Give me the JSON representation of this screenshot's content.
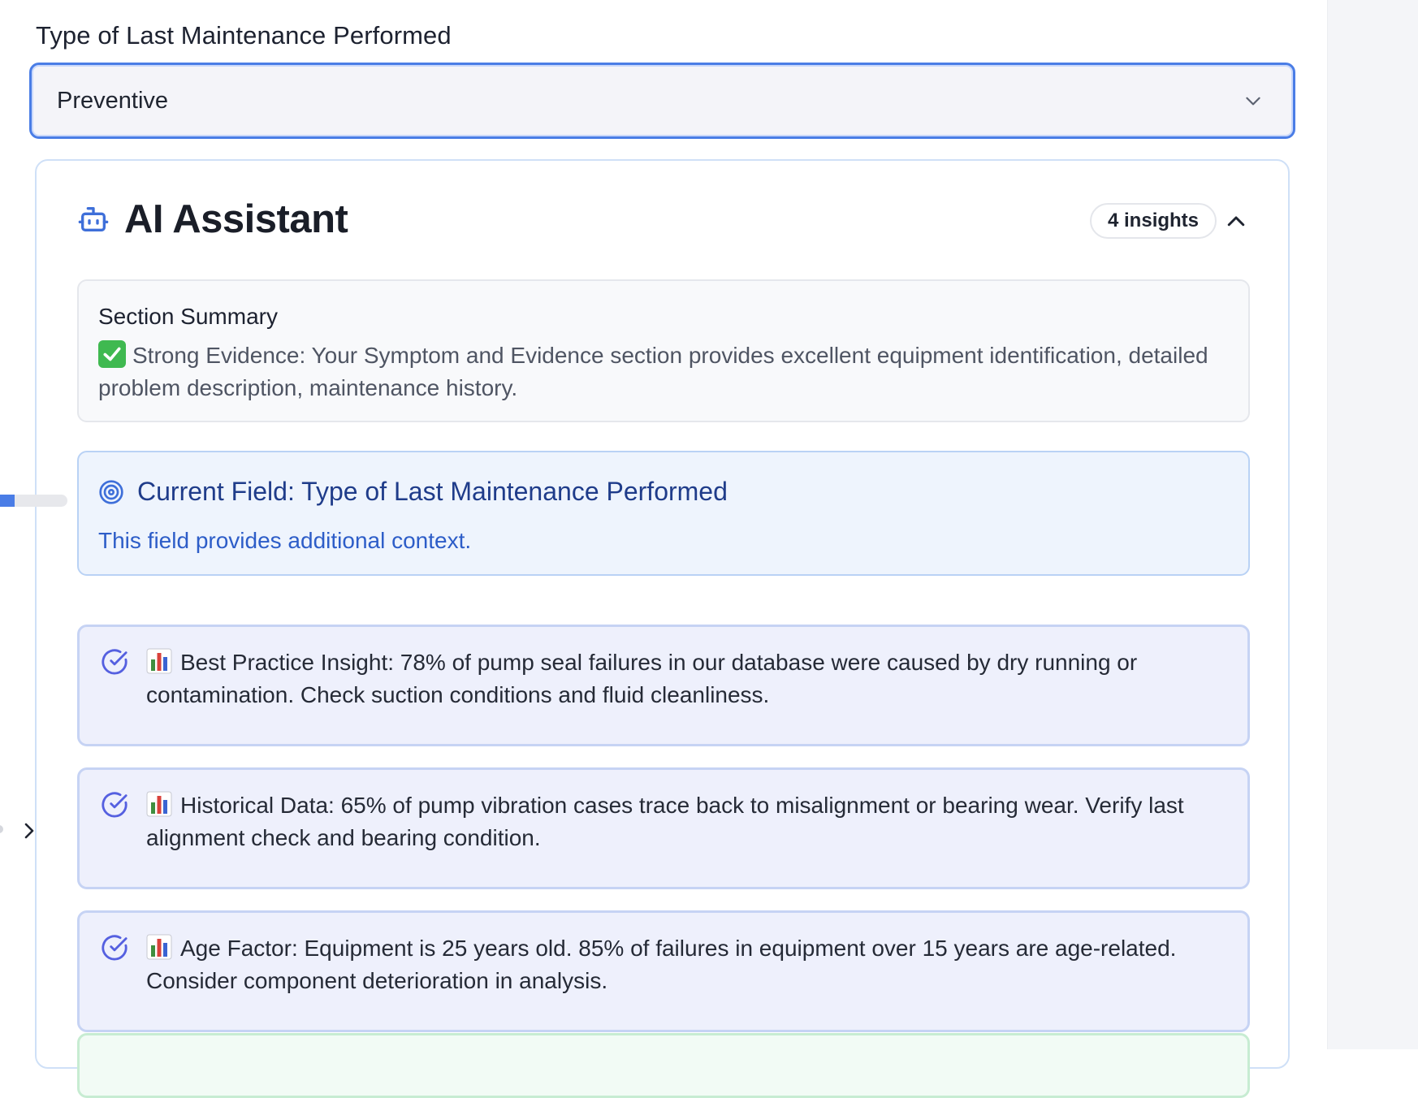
{
  "field": {
    "label": "Type of Last Maintenance Performed",
    "selected_value": "Preventive"
  },
  "ai_assistant": {
    "title": "AI Assistant",
    "insights_badge": "4 insights",
    "summary": {
      "title": "Section Summary",
      "text": "Strong Evidence: Your Symptom and Evidence section provides excellent equipment identification, detailed problem description, maintenance history."
    },
    "current_field": {
      "title": "Current Field: Type of Last Maintenance Performed",
      "description": "This field provides additional context."
    },
    "insights": [
      {
        "text": "Best Practice Insight: 78% of pump seal failures in our database were caused by dry running or contamination. Check suction conditions and fluid cleanliness."
      },
      {
        "text": "Historical Data: 65% of pump vibration cases trace back to misalignment or bearing wear. Verify last alignment check and bearing condition."
      },
      {
        "text": "Age Factor: Equipment is 25 years old. 85% of failures in equipment over 15 years are age-related. Consider component deterioration in analysis."
      }
    ]
  },
  "left_progress": {
    "fraction": 0.22
  },
  "colors": {
    "accent": "#4a7de6",
    "current_field_text": "#1f3c8a",
    "insight_bg": "#eef0fc"
  }
}
